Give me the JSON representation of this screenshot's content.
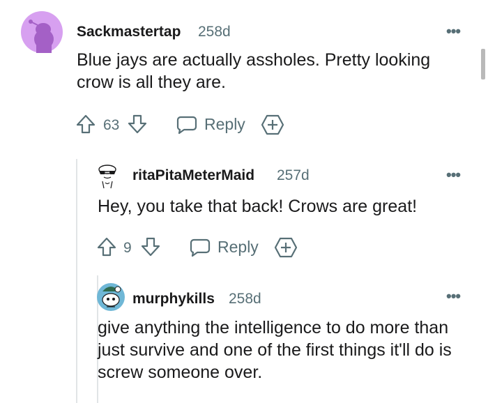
{
  "comments": [
    {
      "username": "Sackmastertap",
      "age": "258d",
      "text": "Blue jays are actually assholes. Pretty looking crow is all they are.",
      "votes": "63",
      "reply_label": "Reply",
      "more_label": "•••"
    },
    {
      "username": "ritaPitaMeterMaid",
      "age": "257d",
      "text": "Hey, you take that back! Crows are great!",
      "votes": "9",
      "reply_label": "Reply",
      "more_label": "•••"
    },
    {
      "username": "murphykills",
      "age": "258d",
      "text": "give anything the intelligence to do more than just survive and one of the first things it'll do is screw someone over.",
      "votes": "",
      "reply_label": "",
      "more_label": "•••"
    }
  ],
  "colors": {
    "avatar1_bg": "#d7a0f0",
    "avatar1_fg": "#a460c6",
    "text": "#1a1a1b",
    "meta": "#576f76",
    "thread_line": "#e1e4e6",
    "scrollbar": "#b9b9b9"
  },
  "icons": [
    "snoo-avatar-icon",
    "sunglasses-avatar-icon",
    "blue-snoo-avatar-icon",
    "upvote-icon",
    "downvote-icon",
    "comment-bubble-icon",
    "award-icon",
    "more-options-icon"
  ]
}
